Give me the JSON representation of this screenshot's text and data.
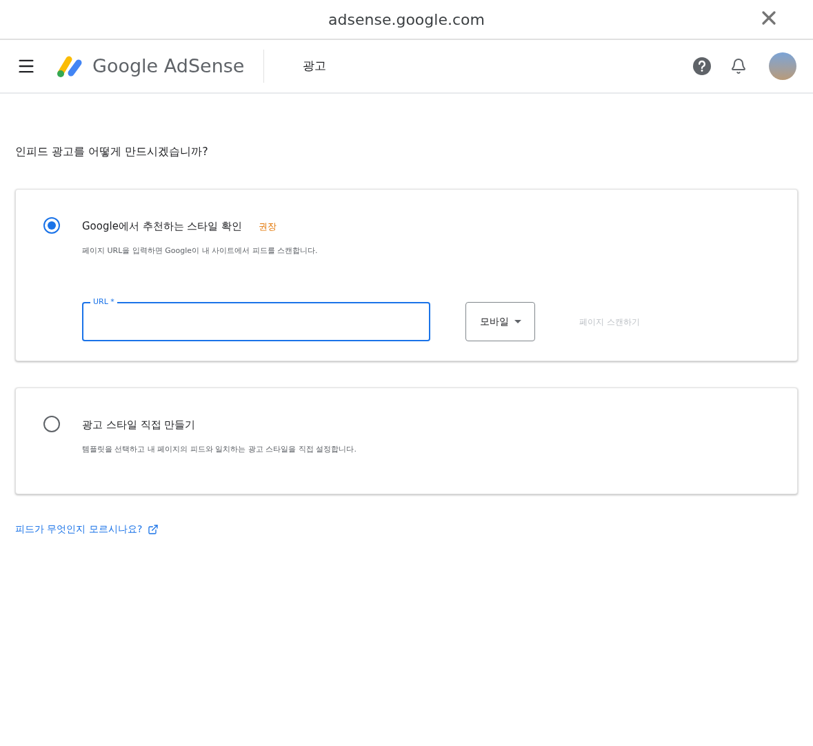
{
  "browser_bar": {
    "url": "adsense.google.com"
  },
  "header": {
    "logo_text": "Google AdSense",
    "section": "광고"
  },
  "question": "인피드 광고를 어떻게 만드시겠습니까?",
  "options": [
    {
      "kind": "scan",
      "selected": true,
      "title": "Google에서 추천하는 스타일 확인",
      "badge": "권장",
      "description": "페이지 URL을 입력하면 Google이 내 사이트에서 피드를 스캔합니다.",
      "url_field": {
        "label": "URL *"
      },
      "device_select": {
        "value": "모바일"
      },
      "scan_button": {
        "label": "페이지 스캔하기",
        "disabled": true
      }
    },
    {
      "kind": "manual",
      "selected": false,
      "title": "광고 스타일 직접 만들기",
      "description": "템플릿을 선택하고 내 페이지의 피드와 일치하는 광고 스타일을 직접 설정합니다."
    }
  ],
  "help_link": "피드가 무엇인지 모르시나요?"
}
